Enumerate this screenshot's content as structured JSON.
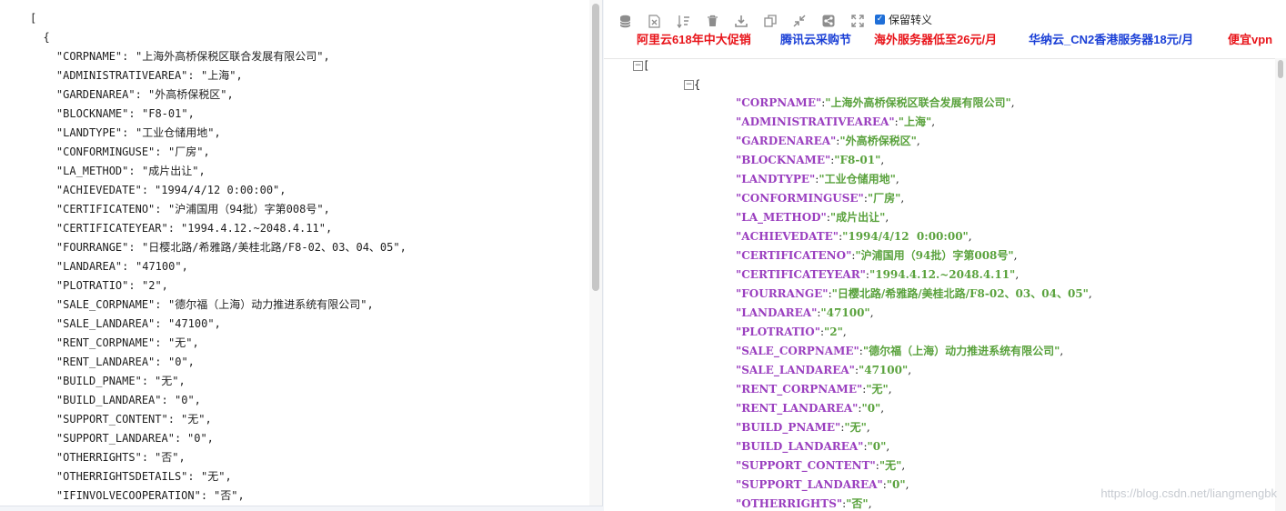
{
  "raw_editor": {
    "lines": [
      [
        "[",
        ""
      ],
      [
        "  {",
        ""
      ],
      [
        "    \"CORPNAME\": ",
        "\"上海外高桥保税区联合发展有限公司\","
      ],
      [
        "    \"ADMINISTRATIVEAREA\": ",
        "\"上海\","
      ],
      [
        "    \"GARDENAREA\": ",
        "\"外高桥保税区\","
      ],
      [
        "    \"BLOCKNAME\": ",
        "\"F8-01\","
      ],
      [
        "    \"LANDTYPE\": ",
        "\"工业仓储用地\","
      ],
      [
        "    \"CONFORMINGUSE\": ",
        "\"厂房\","
      ],
      [
        "    \"LA_METHOD\": ",
        "\"成片出让\","
      ],
      [
        "    \"ACHIEVEDATE\": ",
        "\"1994/4/12 0:00:00\","
      ],
      [
        "    \"CERTIFICATENO\": ",
        "\"沪浦国用（94批）字第008号\","
      ],
      [
        "    \"CERTIFICATEYEAR\": ",
        "\"1994.4.12.~2048.4.11\","
      ],
      [
        "    \"FOURRANGE\": ",
        "\"日樱北路/希雅路/美桂北路/F8-02、03、04、05\","
      ],
      [
        "    \"LANDAREA\": ",
        "\"47100\","
      ],
      [
        "    \"PLOTRATIO\": ",
        "\"2\","
      ],
      [
        "    \"SALE_CORPNAME\": ",
        "\"德尔福（上海）动力推进系统有限公司\","
      ],
      [
        "    \"SALE_LANDAREA\": ",
        "\"47100\","
      ],
      [
        "    \"RENT_CORPNAME\": ",
        "\"无\","
      ],
      [
        "    \"RENT_LANDAREA\": ",
        "\"0\","
      ],
      [
        "    \"BUILD_PNAME\": ",
        "\"无\","
      ],
      [
        "    \"BUILD_LANDAREA\": ",
        "\"0\","
      ],
      [
        "    \"SUPPORT_CONTENT\": ",
        "\"无\","
      ],
      [
        "    \"SUPPORT_LANDAREA\": ",
        "\"0\","
      ],
      [
        "    \"OTHERRIGHTS\": ",
        "\"否\","
      ],
      [
        "    \"OTHERRIGHTSDETAILS\": ",
        "\"无\","
      ],
      [
        "    \"IFINVOLVECOOPERATION\": ",
        "\"否\","
      ]
    ]
  },
  "toolbar": {
    "icons": [
      "database-icon",
      "excel-icon",
      "sort-icon",
      "trash-icon",
      "download-icon",
      "copy-icon",
      "compress-icon",
      "share-icon",
      "fullscreen-icon"
    ],
    "keep_escape_label": "保留转义",
    "keep_escape_checked": true
  },
  "ads": [
    {
      "text": "阿里云618年中大促销",
      "color": "#e8141a"
    },
    {
      "text": "腾讯云采购节",
      "color": "#1a3fd6"
    },
    {
      "text": "海外服务器低至26元/月",
      "color": "#e8141a"
    },
    {
      "text": "华纳云_CN2香港服务器18元/月",
      "color": "#1a3fd6"
    },
    {
      "text": "便宜vpn",
      "color": "#e8141a"
    }
  ],
  "tree": {
    "open_array": "[",
    "open_object": "{",
    "pairs": [
      [
        "\"CORPNAME\"",
        "\"上海外高桥保税区联合发展有限公司\""
      ],
      [
        "\"ADMINISTRATIVEAREA\"",
        "\"上海\""
      ],
      [
        "\"GARDENAREA\"",
        "\"外高桥保税区\""
      ],
      [
        "\"BLOCKNAME\"",
        "\"F8-01\""
      ],
      [
        "\"LANDTYPE\"",
        "\"工业仓储用地\""
      ],
      [
        "\"CONFORMINGUSE\"",
        "\"厂房\""
      ],
      [
        "\"LA_METHOD\"",
        "\"成片出让\""
      ],
      [
        "\"ACHIEVEDATE\"",
        "\"1994/4/12  0:00:00\""
      ],
      [
        "\"CERTIFICATENO\"",
        "\"沪浦国用（94批）字第008号\""
      ],
      [
        "\"CERTIFICATEYEAR\"",
        "\"1994.4.12.~2048.4.11\""
      ],
      [
        "\"FOURRANGE\"",
        "\"日樱北路/希雅路/美桂北路/F8-02、03、04、05\""
      ],
      [
        "\"LANDAREA\"",
        "\"47100\""
      ],
      [
        "\"PLOTRATIO\"",
        "\"2\""
      ],
      [
        "\"SALE_CORPNAME\"",
        "\"德尔福（上海）动力推进系统有限公司\""
      ],
      [
        "\"SALE_LANDAREA\"",
        "\"47100\""
      ],
      [
        "\"RENT_CORPNAME\"",
        "\"无\""
      ],
      [
        "\"RENT_LANDAREA\"",
        "\"0\""
      ],
      [
        "\"BUILD_PNAME\"",
        "\"无\""
      ],
      [
        "\"BUILD_LANDAREA\"",
        "\"0\""
      ],
      [
        "\"SUPPORT_CONTENT\"",
        "\"无\""
      ],
      [
        "\"SUPPORT_LANDAREA\"",
        "\"0\""
      ],
      [
        "\"OTHERRIGHTS\"",
        "\"否\""
      ]
    ]
  },
  "watermark": "https://blog.csdn.net/liangmengbk"
}
